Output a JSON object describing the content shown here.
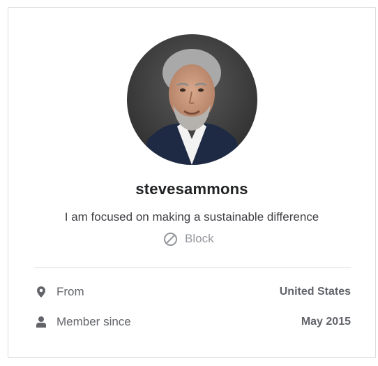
{
  "profile": {
    "username": "stevesammons",
    "tagline": "I am focused on making a sustainable difference",
    "block_label": "Block",
    "avatar_alt": "profile photo"
  },
  "details": {
    "from": {
      "icon": "location-pin-icon",
      "label": "From",
      "value": "United States"
    },
    "member_since": {
      "icon": "user-icon",
      "label": "Member since",
      "value": "May 2015"
    }
  },
  "colors": {
    "text_primary": "#222325",
    "text_secondary": "#62646a",
    "text_muted": "#95979d",
    "border": "#dadbdd"
  }
}
